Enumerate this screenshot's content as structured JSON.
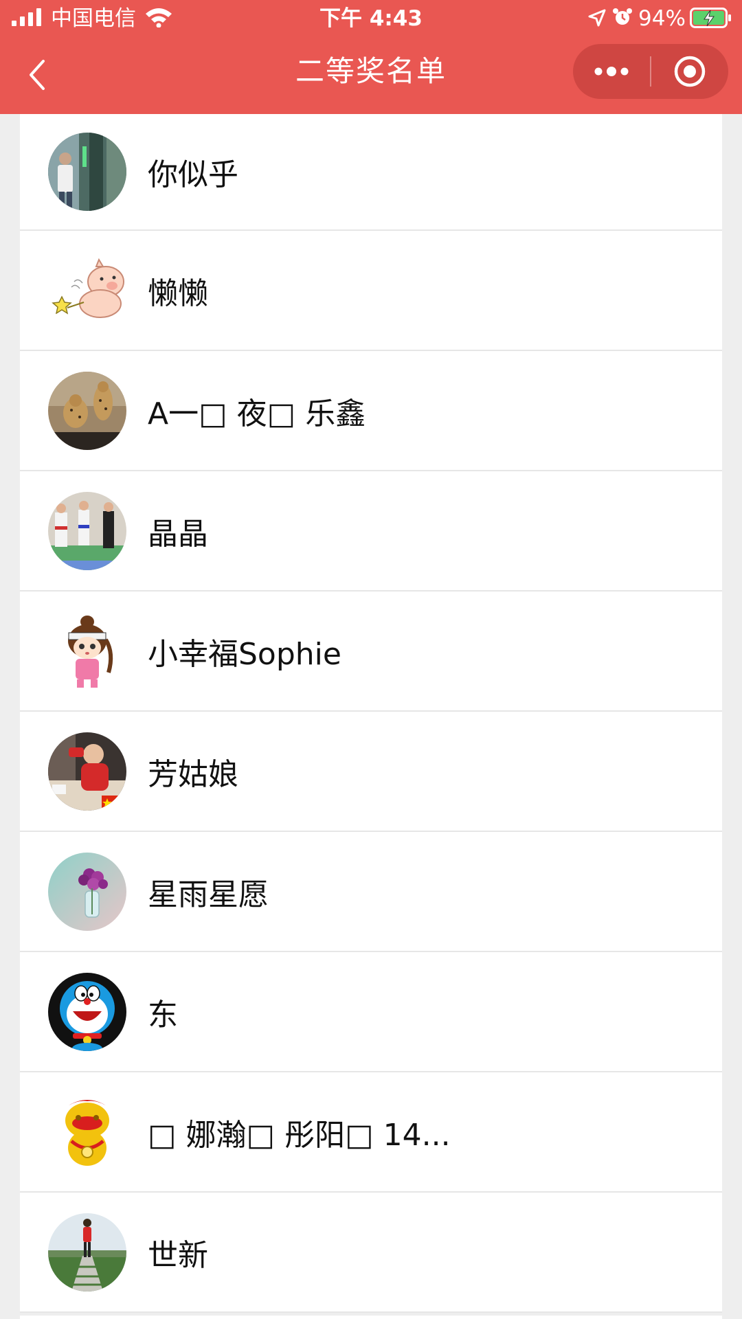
{
  "status_bar": {
    "carrier": "中国电信",
    "time": "下午 4:43",
    "battery_percent": "94%"
  },
  "nav": {
    "title": "二等奖名单",
    "back_icon": "chevron-left-icon",
    "more_icon": "more-dots-icon",
    "close_icon": "target-close-icon"
  },
  "colors": {
    "header_bg": "#e95752",
    "page_bg": "#eeeeee",
    "list_bg": "#ffffff",
    "text": "#111111"
  },
  "winners": [
    {
      "name": "你似乎"
    },
    {
      "name": "懒懒"
    },
    {
      "name": "A一□ 夜□ 乐鑫"
    },
    {
      "name": "晶晶"
    },
    {
      "name": "小幸福Sophie"
    },
    {
      "name": "芳姑娘"
    },
    {
      "name": "星雨星愿"
    },
    {
      "name": "东"
    },
    {
      "name": "□  娜瀚□  彤阳□ 14..."
    },
    {
      "name": "世新"
    }
  ]
}
